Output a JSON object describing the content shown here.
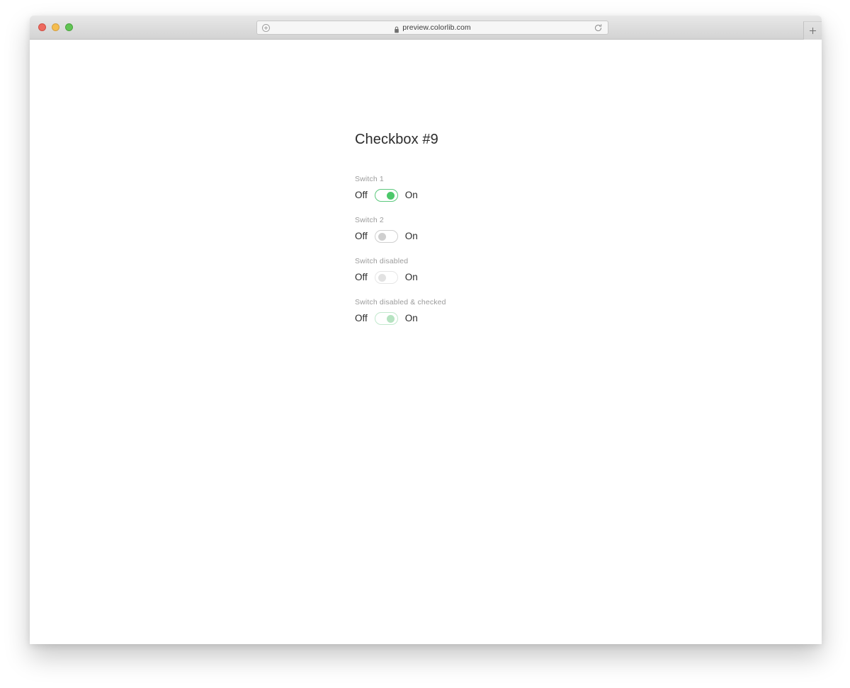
{
  "browser": {
    "traffic_lights": {
      "close_label": "close",
      "minimize_label": "minimize",
      "maximize_label": "maximize"
    },
    "address": {
      "url": "preview.colorlib.com",
      "left_icon": "add-circle-icon",
      "lock_icon": "lock-icon",
      "reload_icon": "reload-icon"
    },
    "new_tab_label": "+"
  },
  "page": {
    "title": "Checkbox #9",
    "switches": [
      {
        "label": "Switch 1",
        "off_text": "Off",
        "on_text": "On",
        "state": "on",
        "disabled": false
      },
      {
        "label": "Switch 2",
        "off_text": "Off",
        "on_text": "On",
        "state": "off",
        "disabled": false
      },
      {
        "label": "Switch disabled",
        "off_text": "Off",
        "on_text": "On",
        "state": "off",
        "disabled": true
      },
      {
        "label": "Switch disabled & checked",
        "off_text": "Off",
        "on_text": "On",
        "state": "on",
        "disabled": true
      }
    ]
  },
  "colors": {
    "accent_green": "#4cc86a",
    "accent_green_border": "#5bc87c",
    "accent_green_faded": "#b6e3c1",
    "track_gray": "#cfcfcf",
    "track_gray_disabled": "#e2e2e2",
    "label_gray": "#9b9b9b",
    "text_dark": "#2b2b2b"
  }
}
